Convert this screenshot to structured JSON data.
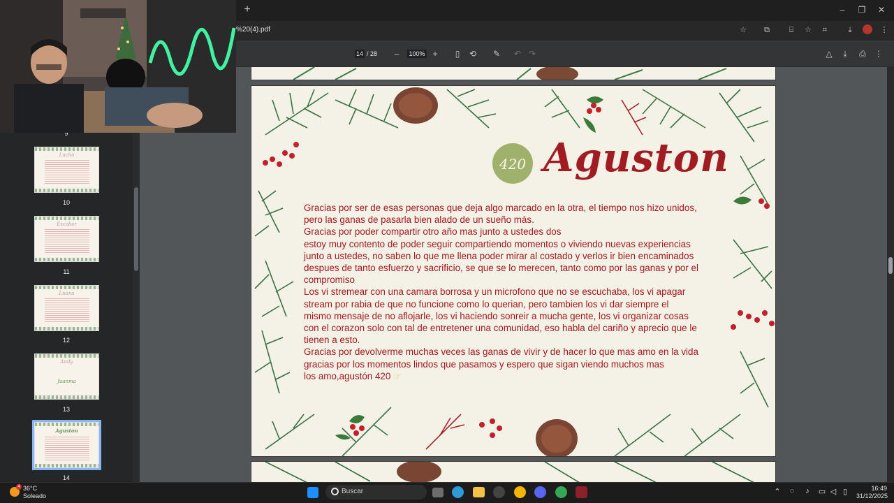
{
  "browser": {
    "url": "%20(4).pdf",
    "new_tab_glyph": "+",
    "window_controls": [
      "–",
      "❐",
      "✕"
    ],
    "omnibox_icons": [
      "star-icon",
      "extensions-icon",
      "translate-icon",
      "bookmark-icon",
      "lens-icon",
      "downloads-icon",
      "profile-icon",
      "menu-icon"
    ]
  },
  "pdf_toolbar": {
    "current_page": "14",
    "total_pages": "/ 28",
    "zoom": "100%",
    "zoom_out": "–",
    "zoom_in": "+"
  },
  "sidebar": {
    "thumbnails": [
      {
        "number": "10",
        "name": "Lucho",
        "name2": ""
      },
      {
        "number": "11",
        "name": "Escobar",
        "name2": ""
      },
      {
        "number": "12",
        "name": "Luana",
        "name2": ""
      },
      {
        "number": "13",
        "name": "Andy",
        "name2": "Juanma"
      },
      {
        "number": "14",
        "name": "Aguston",
        "name2": ""
      }
    ],
    "top_partial_number": "9"
  },
  "page": {
    "badge": "420",
    "name": "Aguston",
    "lines": [
      "Gracias por ser de esas personas que deja algo marcado en la otra, el tiempo nos hizo unidos,",
      "pero las ganas de pasarla bien alado de un sueño más.",
      "Gracias por poder compartir otro año mas junto a ustedes dos",
      "estoy muy contento de poder seguir compartiendo momentos o viviendo nuevas experiencias",
      "junto a ustedes, no saben lo que me llena poder mirar al costado y verlos ir bien encaminados",
      "despues de tanto esfuerzo y sacrificio, se que se lo merecen, tanto como por las ganas y por el",
      "compromiso",
      "Los vi stremear con una camara borrosa y un microfono que no se escuchaba, los vi apagar",
      "stream por rabia de que no funcione como lo querian, pero tambien los vi dar siempre el",
      "mismo mensaje de no aflojarle, los vi haciendo sonreir a mucha gente, los vi organizar cosas",
      "con el corazon solo con tal de entretener una comunidad, eso habla del cariño y aprecio que le",
      "tienen a esto.",
      "Gracias por devolverme muchas veces las ganas de vivir y de hacer lo que mas amo en la vida",
      "gracias por los momentos lindos que pasamos y espero que sigan viendo muchos mas",
      "los amo,agustón 420"
    ]
  },
  "taskbar": {
    "weather_temp": "36°C",
    "weather_condition": "Soleado",
    "weather_badge": "4",
    "search_placeholder": "Buscar",
    "time": "16:49",
    "date": "31/12/2025"
  },
  "colors": {
    "letter_text": "#a2181f",
    "title": "#a01c22",
    "badge": "#9fb16a",
    "page_bg": "#f4f1e6",
    "viewer_bg": "#525659"
  }
}
